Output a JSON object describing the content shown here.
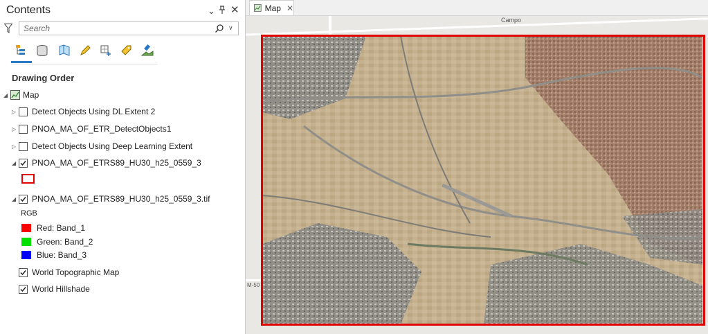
{
  "contents_pane": {
    "title": "Contents",
    "search_placeholder": "Search",
    "section_title": "Drawing Order",
    "tools": [
      {
        "icon": "list-by-drawing-order-icon"
      },
      {
        "icon": "list-by-source-icon"
      },
      {
        "icon": "list-by-selection-icon"
      },
      {
        "icon": "list-by-editing-icon"
      },
      {
        "icon": "list-by-snapping-icon"
      },
      {
        "icon": "list-by-labeling-icon"
      },
      {
        "icon": "list-by-perspective-imagery-icon"
      }
    ],
    "tree": {
      "map_label": "Map",
      "layers": [
        {
          "label": "Detect Objects Using DL Extent 2",
          "checked": false
        },
        {
          "label": "PNOA_MA_OF_ETR_DetectObjects1",
          "checked": false
        },
        {
          "label": "Detect Objects Using Deep Learning Extent",
          "checked": false
        },
        {
          "label": "PNOA_MA_OF_ETRS89_HU30_h25_0559_3",
          "checked": true
        },
        {
          "label": "PNOA_MA_OF_ETRS89_HU30_h25_0559_3.tif",
          "checked": true
        },
        {
          "label": "World Topographic Map",
          "checked": true
        },
        {
          "label": "World Hillshade",
          "checked": true
        }
      ],
      "rgb_label": "RGB",
      "bands": [
        {
          "label": "Red:  Band_1",
          "color": "#ff0000"
        },
        {
          "label": "Green: Band_2",
          "color": "#00e000"
        },
        {
          "label": "Blue:  Band_3",
          "color": "#0000ff"
        }
      ],
      "extent_outline_color": "#e00000"
    }
  },
  "map_tab": {
    "label": "Map"
  },
  "map_view": {
    "basemap_labels": [
      "Campo",
      "M-50"
    ]
  }
}
